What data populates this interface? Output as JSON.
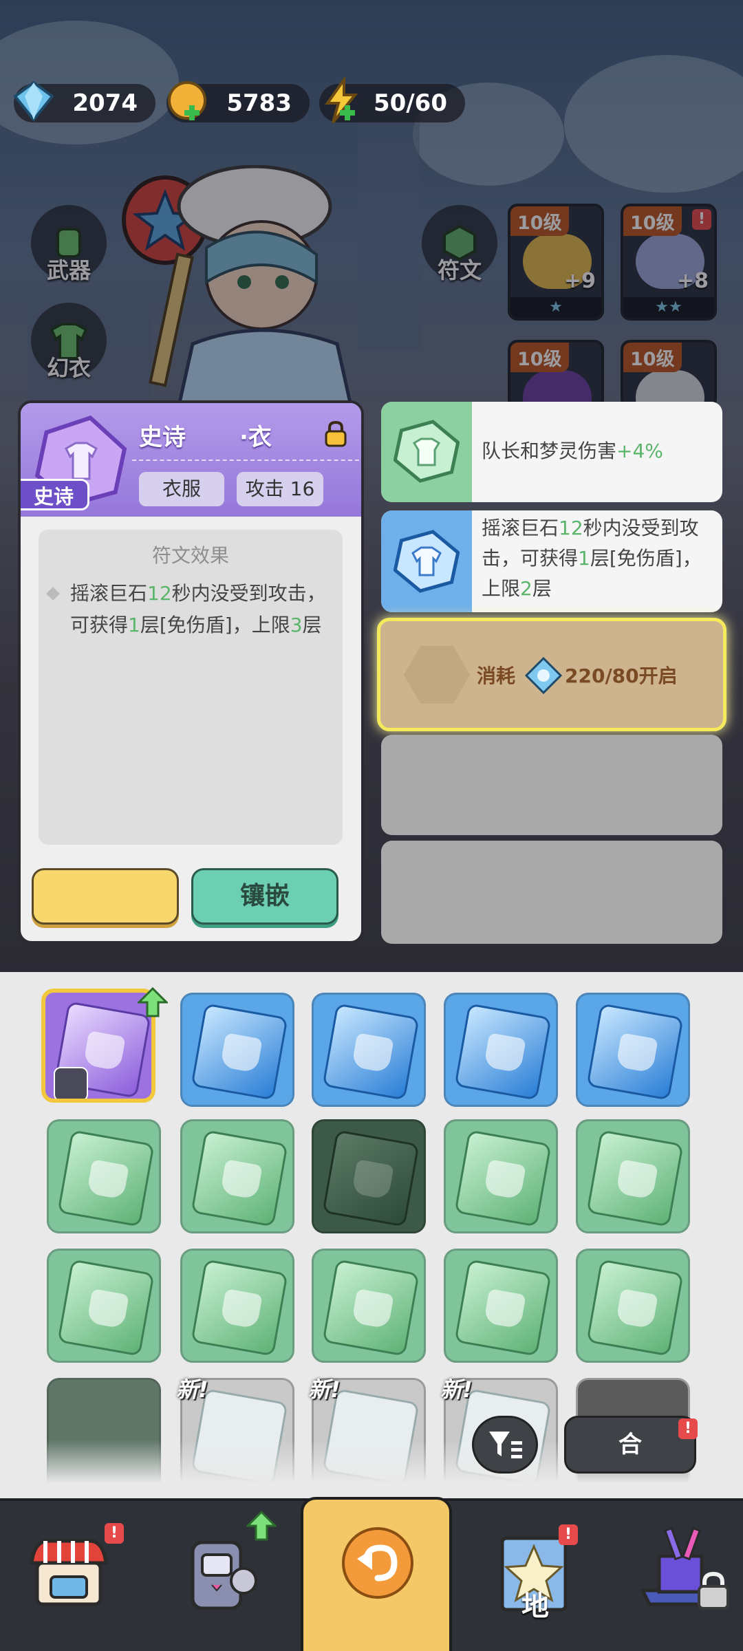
{
  "currencies": [
    {
      "name": "diamond",
      "icon": "diamond-icon",
      "value": "2074"
    },
    {
      "name": "coin",
      "icon": "coin-icon",
      "value": "5783"
    },
    {
      "name": "energy",
      "icon": "lightning-icon",
      "value": "50/60"
    }
  ],
  "side_menu": {
    "weapon": "武器",
    "costume": "幻衣",
    "rune": "符文"
  },
  "equipment_slots": [
    {
      "level": "10级",
      "plus": "+9",
      "stars": "★"
    },
    {
      "level": "10级",
      "plus": "+8",
      "stars": "★★"
    },
    {
      "level": "10级",
      "plus": "",
      "stars": ""
    },
    {
      "level": "10级",
      "plus": "",
      "stars": ""
    }
  ],
  "detail": {
    "title_left": "史诗",
    "title_right": "·衣",
    "rarity_badge": "史诗",
    "tag_type": "衣服",
    "tag_stat": "攻击 16",
    "rune_section_title": "符文效果",
    "rune_text": {
      "p1": "摇滚巨石",
      "n1": "12",
      "p2": "秒内没受到攻击，可获得",
      "n2": "1",
      "p3": "层[免伤盾]，上限",
      "n3": "3",
      "p4": "层"
    },
    "inlay_button": "镶嵌"
  },
  "effects": [
    {
      "text": "队长和梦灵伤害",
      "bonus": "+4%"
    },
    {
      "p1": "摇滚巨石",
      "n1": "12",
      "p2": "秒内没受到攻击，可获得",
      "n2": "1",
      "p3": "层[免伤盾]，上限",
      "n3": "2",
      "p4": "层"
    }
  ],
  "consume": {
    "label": "消耗",
    "value": "220/80开启"
  },
  "inventory": {
    "new_tag": "新!",
    "merge_button": "合",
    "alert_mark": "!"
  },
  "bottom_nav": {
    "map_label": "地"
  },
  "colors": {
    "accent_green": "#5ab56a",
    "rarity_purple": "#6d4fc7",
    "highlight_yellow": "#f4ea5c"
  }
}
